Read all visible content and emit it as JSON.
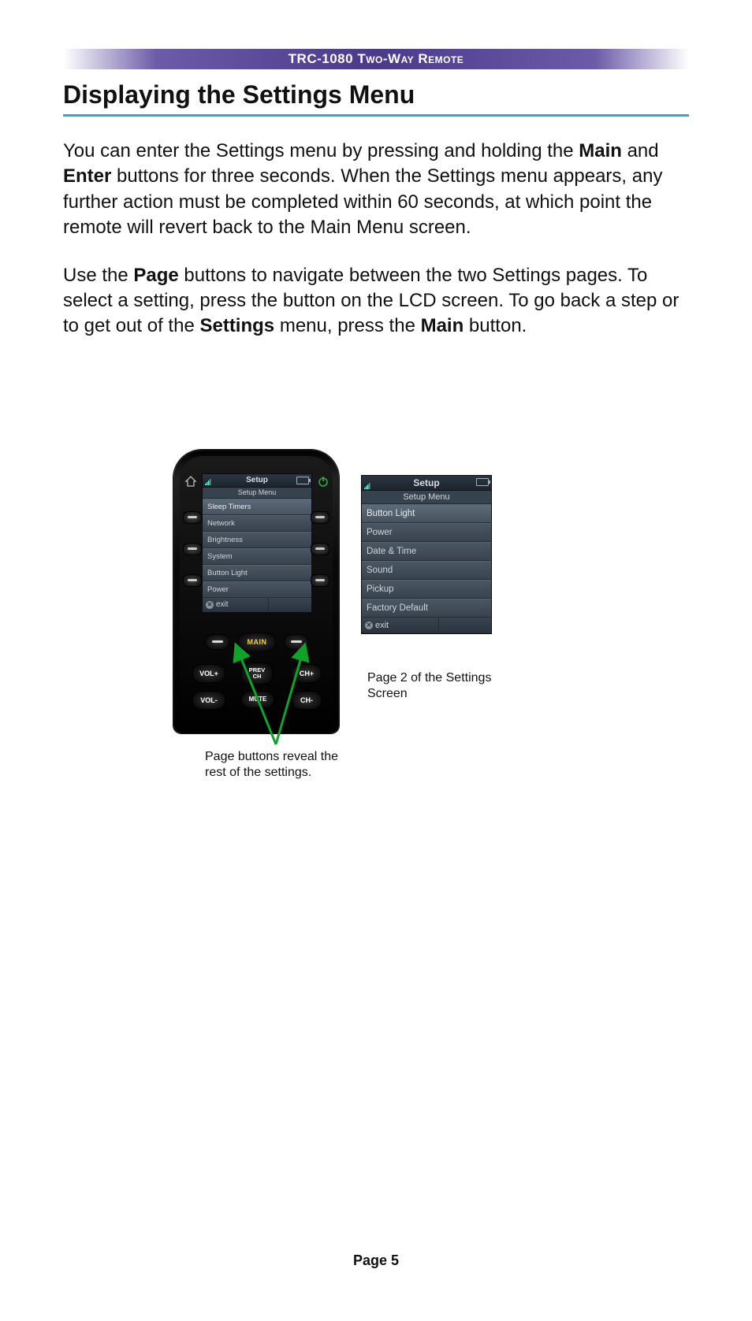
{
  "header": {
    "title": "TRC-1080 Two-Way Remote"
  },
  "section": {
    "title": "Displaying the Settings Menu"
  },
  "para1": {
    "a": "You can enter the Settings menu by pressing and holding the ",
    "b1": "Main",
    "c": " and ",
    "b2": "Enter",
    "d": " buttons for three seconds.  When the Settings menu appears, any further action must be completed within 60 seconds, at which point the remote will revert back to the Main Menu screen."
  },
  "para2": {
    "a": "Use the ",
    "b1": "Page",
    "c": " buttons to navigate between the two Settings pages. To select a setting, press the button on the LCD screen. To go back a step or to get out of the ",
    "b2": "Settings",
    "d": " menu, press the ",
    "b3": "Main",
    "e": " button."
  },
  "remote": {
    "lcd": {
      "title": "Setup",
      "subtitle": "Setup Menu",
      "items": [
        "Sleep Timers",
        "Network",
        "Brightness",
        "System",
        "Button Light",
        "Power"
      ],
      "exit": "exit"
    },
    "buttons": {
      "main": "MAIN",
      "vol_up": "VOL+",
      "vol_down": "VOL-",
      "prev_ch": "PREV\nCH",
      "mute": "MUTE",
      "ch_up": "CH+",
      "ch_down": "CH-"
    }
  },
  "panel2": {
    "title": "Setup",
    "subtitle": "Setup Menu",
    "items": [
      "Button Light",
      "Power",
      "Date & Time",
      "Sound",
      "Pickup",
      "Factory Default"
    ],
    "exit": "exit"
  },
  "captions": {
    "c1": "Page buttons reveal the rest of the settings.",
    "c2": "Page 2 of the Settings Screen"
  },
  "footer": {
    "page": "Page 5"
  }
}
